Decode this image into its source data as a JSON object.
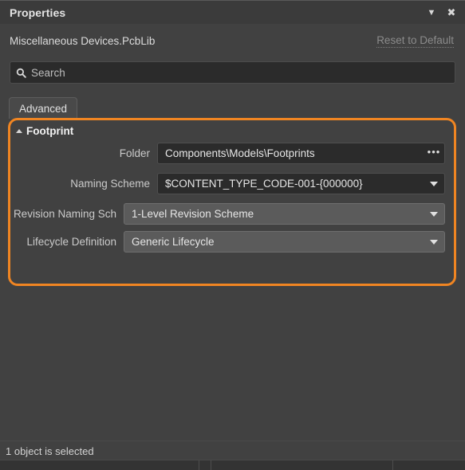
{
  "titlebar": {
    "title": "Properties",
    "collapse_icon": "chevron-down-icon",
    "close_icon": "close-icon"
  },
  "subheader": {
    "document_name": "Miscellaneous Devices.PcbLib",
    "reset_label": "Reset to Default"
  },
  "search": {
    "placeholder": "Search",
    "value": "",
    "icon": "search-icon"
  },
  "tabs": [
    {
      "label": "Advanced",
      "active": true
    }
  ],
  "section": {
    "title": "Footprint",
    "expanded": true,
    "highlight_color": "#f08522",
    "fields": [
      {
        "label": "Folder",
        "value": "Components\\Models\\Footprints",
        "control": "text-with-browse",
        "adornment": "ellipsis-icon",
        "style": "dark"
      },
      {
        "label": "Naming Scheme",
        "value": "$CONTENT_TYPE_CODE-001-{000000}",
        "control": "dropdown",
        "adornment": "caret-down-icon",
        "style": "dark"
      },
      {
        "label": "Revision Naming Sch",
        "value": "1-Level Revision Scheme",
        "control": "dropdown",
        "adornment": "caret-down-icon",
        "style": "light"
      },
      {
        "label": "Lifecycle Definition",
        "value": "Generic Lifecycle",
        "control": "dropdown",
        "adornment": "caret-down-icon",
        "style": "light"
      }
    ]
  },
  "statusbar": {
    "text": "1 object is selected"
  }
}
